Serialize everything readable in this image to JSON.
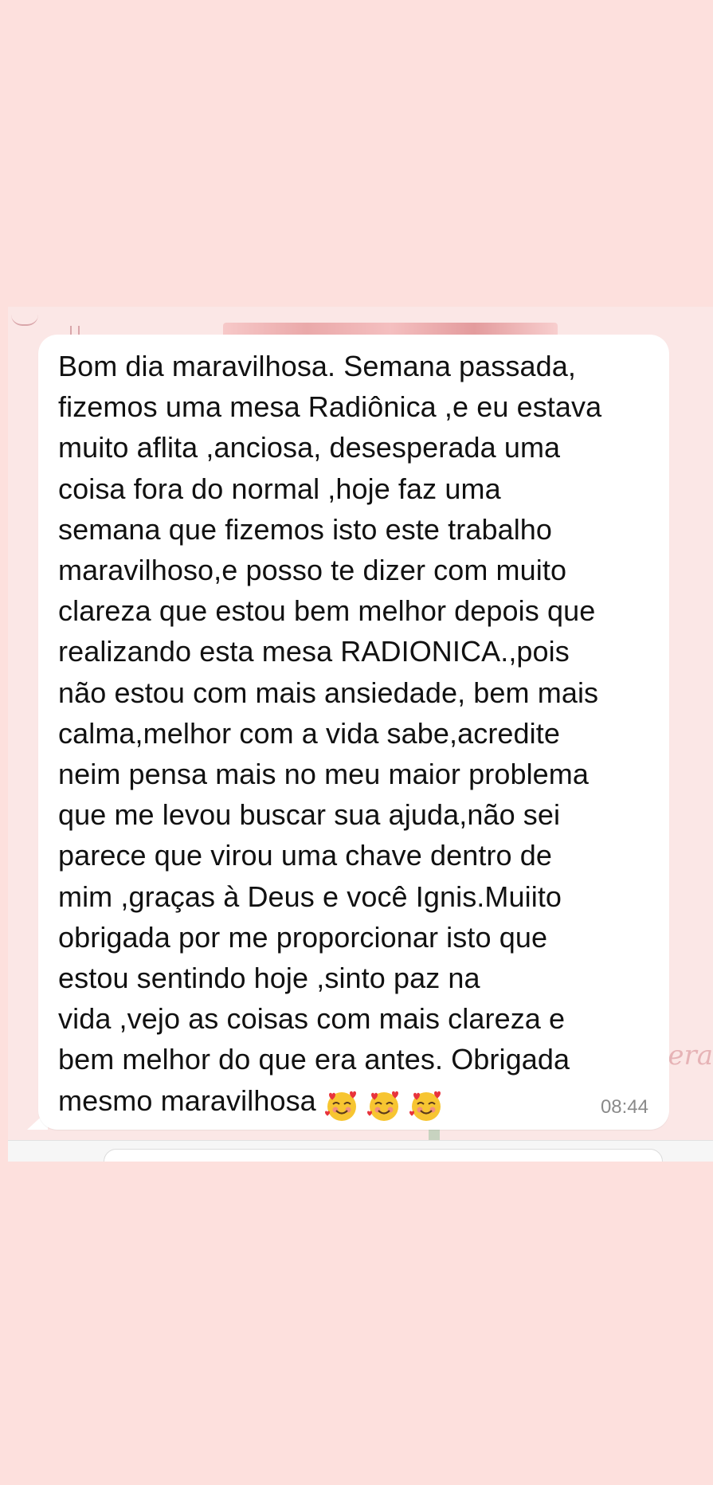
{
  "message": {
    "lines": [
      "Bom dia maravilhosa. Semana passada,",
      "fizemos uma mesa Radiônica ,e eu estava",
      "muito aflita ,anciosa, desesperada uma",
      "coisa fora do normal ,hoje faz uma",
      "semana que fizemos isto este trabalho",
      "maravilhoso,e posso te dizer com muito",
      "clareza que estou bem melhor depois que",
      "realizando esta mesa RADIONICA.,pois",
      "não estou com mais ansiedade, bem mais",
      "calma,melhor com a vida sabe,acredite",
      "neim pensa mais no meu maior problema",
      "que me levou buscar sua ajuda,não sei",
      "parece que virou uma chave dentro de",
      "mim ,graças à Deus e você Ignis.Muiito",
      "obrigada por me proporcionar isto que",
      "estou sentindo hoje ,sinto paz na",
      "vida ,vejo as coisas com mais clareza e",
      "bem melhor do que era antes. Obrigada",
      "mesmo maravilhosa"
    ],
    "emojis": [
      "smiling-face-with-hearts",
      "smiling-face-with-hearts",
      "smiling-face-with-hearts"
    ],
    "time": "08:44"
  },
  "wallpaper": {
    "script_text": "era"
  },
  "colors": {
    "page_background": "#fde0dd",
    "bubble_background": "#ffffff",
    "text": "#111111",
    "timestamp": "#8a8a8a"
  }
}
